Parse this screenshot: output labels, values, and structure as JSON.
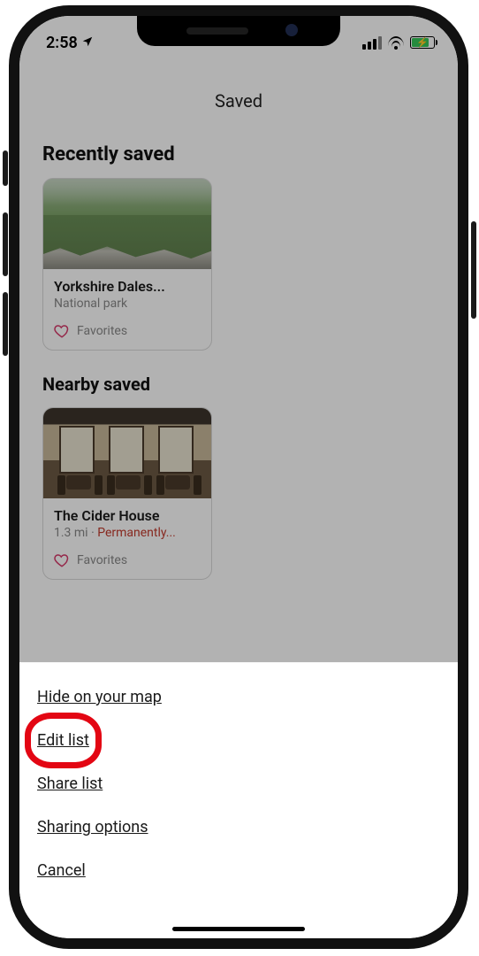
{
  "status": {
    "time": "2:58",
    "location_icon": "location-arrow",
    "battery_pct": 72,
    "battery_charging": true
  },
  "header": {
    "title": "Saved"
  },
  "sections": {
    "recent": {
      "heading": "Recently saved",
      "card": {
        "title": "Yorkshire Dales...",
        "subtitle": "National park",
        "list_icon": "heart-icon",
        "list_label": "Favorites"
      }
    },
    "nearby": {
      "heading": "Nearby saved",
      "card": {
        "title": "The Cider House",
        "distance": "1.3 mi",
        "separator": " · ",
        "status_text": "Permanently...",
        "list_icon": "heart-icon",
        "list_label": "Favorites"
      }
    }
  },
  "action_sheet": {
    "items": [
      {
        "id": "hide",
        "label": "Hide on your map"
      },
      {
        "id": "edit",
        "label": "Edit list"
      },
      {
        "id": "share",
        "label": "Share list"
      },
      {
        "id": "sharing_options",
        "label": "Sharing options"
      },
      {
        "id": "cancel",
        "label": "Cancel"
      }
    ],
    "highlighted_id": "edit"
  },
  "colors": {
    "heart": "#d63a6a",
    "warn": "#c23b2e",
    "highlight_ring": "#e30613",
    "battery_fill": "#35c759"
  }
}
